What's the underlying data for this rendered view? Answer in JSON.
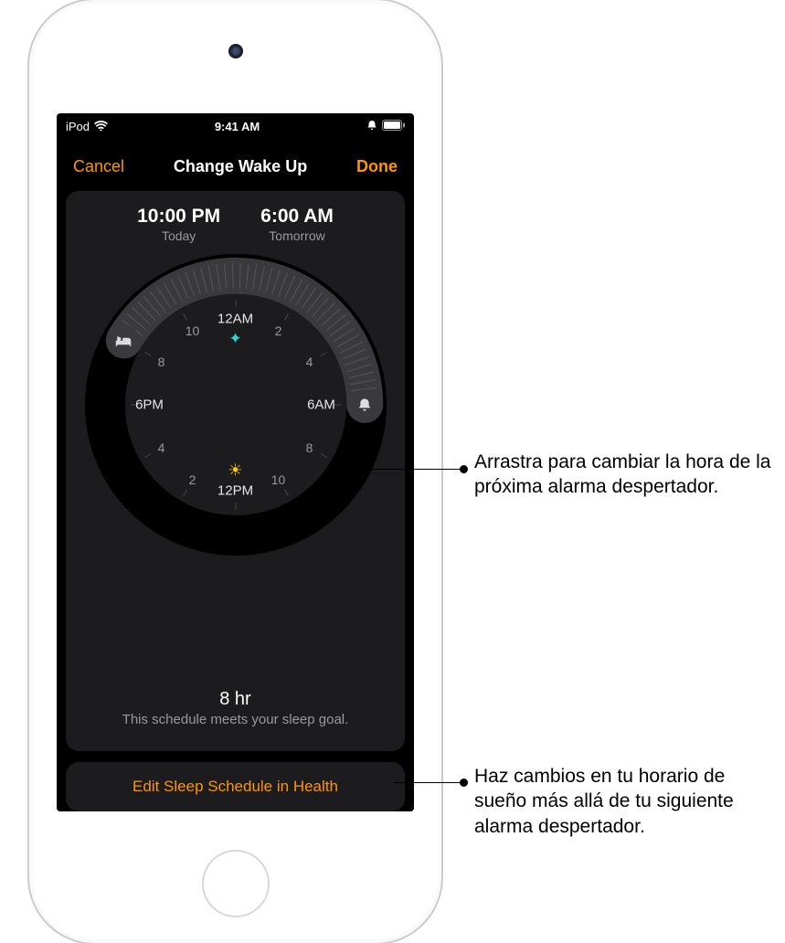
{
  "status": {
    "carrier": "iPod",
    "time": "9:41 AM"
  },
  "nav": {
    "cancel": "Cancel",
    "title": "Change Wake Up",
    "done": "Done"
  },
  "schedule": {
    "bedtime": "10:00 PM",
    "bedtime_rel": "Today",
    "wake": "6:00 AM",
    "wake_rel": "Tomorrow"
  },
  "dial": {
    "h12am": "12AM",
    "h2a": "2",
    "h4a": "4",
    "h6am": "6AM",
    "h8a": "8",
    "h10a": "10",
    "h12pm": "12PM",
    "h2p": "2",
    "h4p": "4",
    "h6pm": "6PM",
    "h8p": "8",
    "h10p": "10"
  },
  "summary": {
    "duration": "8 hr",
    "message": "This schedule meets your sleep goal."
  },
  "edit_label": "Edit Sleep Schedule in Health",
  "callouts": {
    "alarm_drag": "Arrastra para cambiar la hora de la próxima alarma despertador.",
    "edit_schedule": "Haz cambios en tu horario de sueño más allá de tu siguiente alarma despertador."
  }
}
